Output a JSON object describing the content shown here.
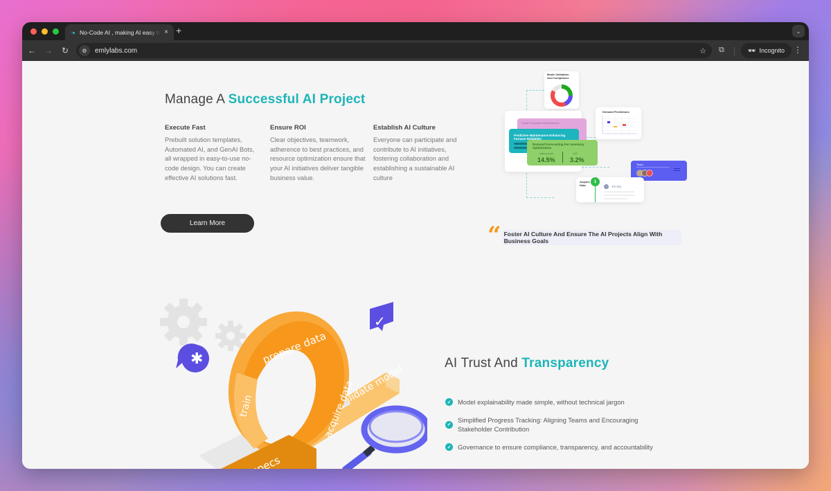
{
  "browser": {
    "tab_title": "No-Code AI , making AI easy to use",
    "tab_close_icon": "×",
    "new_tab_icon": "+",
    "url": "emlylabs.com",
    "incognito_label": "Incognito",
    "back_icon": "←",
    "forward_icon": "→",
    "reload_icon": "↻",
    "bookmark_icon": "☆",
    "menu_icon": "⋮",
    "tab_menu_icon": "⌄"
  },
  "section1": {
    "title_plain": "Manage A ",
    "title_accent": "Successful AI Project",
    "columns": [
      {
        "heading": "Execute Fast",
        "body": "Prebuilt solution templates, Automated AI, and GenAI Bots, all wrapped in easy-to-use no-code design. You can create effective AI solutions fast."
      },
      {
        "heading": "Ensure ROI",
        "body": "Clear objectives, teamwork, adherence to best practices, and resource optimization ensure that your AI initiatives deliver tangible business value."
      },
      {
        "heading": "Establish AI Culture",
        "body": "Everyone can participate and contribute to AI initiatives, fostering collaboration and establishing a sustainable AI culture"
      }
    ],
    "cta_label": "Learn More",
    "illustration": {
      "model_validation_label": "Model Validation And Compliance",
      "demand_predictions_label": "Demand Predictions",
      "trade_promotion_label": "Trade Promotion Effectiveness",
      "predictive_maintenance_label": "Predictive Maintenance Enhancing Furnace Reliability",
      "demand_forecasting_label": "Demand Forecasting For Inventory Optimization",
      "metric1_label": "sales growth",
      "metric1_value": "14.5%",
      "metric2_label": "LDC",
      "metric2_value": "3.2%",
      "team_label": "Team",
      "acquire_label": "Acquire Data",
      "step_number": "1",
      "todo_label": "TO DO"
    },
    "quote": "Foster AI Culture And Ensure The AI Projects Align With Business Goals"
  },
  "section2": {
    "title_plain": "AI Trust And ",
    "title_accent": "Transparency",
    "illustration_labels": [
      "prepare data",
      "train",
      "acquire data",
      "validate model",
      "specs"
    ],
    "checklist": [
      "Model explainability made simple, without technical jargon",
      "Simplified Progress Tracking: Aligning Teams and Encouraging Stakeholder Contribution",
      "Governance to ensure compliance, transparency, and accountability"
    ]
  },
  "colors": {
    "accent": "#1db5b8",
    "button_bg": "#333333",
    "quote_mark": "#f59a1a",
    "illustration_orange": "#f59a1a",
    "illustration_purple": "#5b5ce8"
  }
}
